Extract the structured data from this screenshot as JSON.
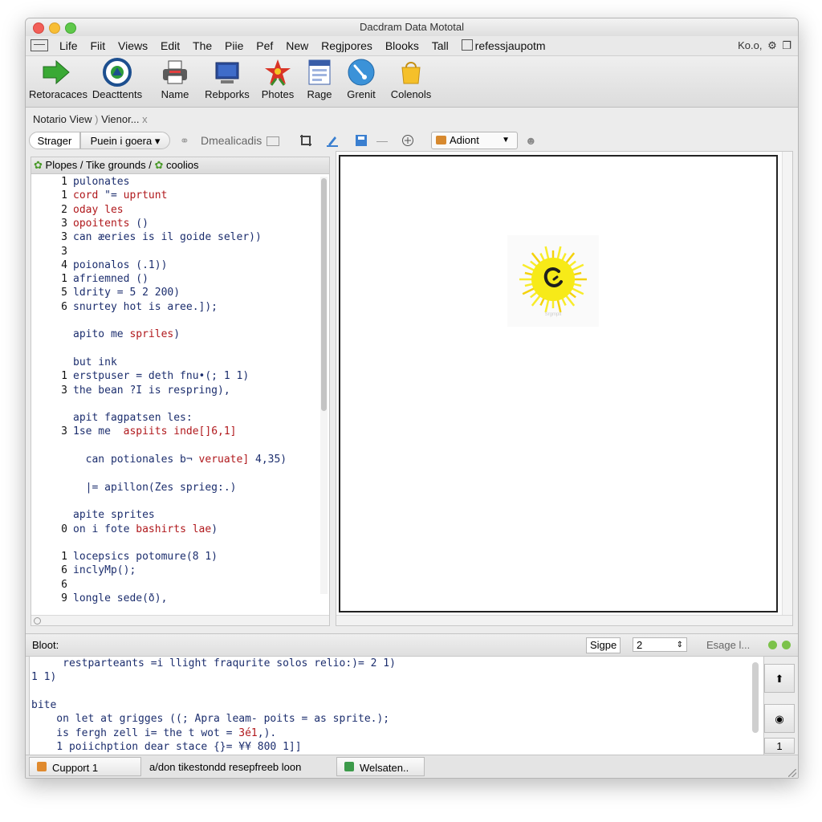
{
  "window": {
    "title": "Dacdram Data Mototal"
  },
  "menubar": {
    "items": [
      "Life",
      "Fiit",
      "Views",
      "Edit",
      "The",
      "Piie",
      "Pef",
      "New",
      "Regjpores",
      "Blooks",
      "Tall"
    ],
    "checkbox_label": "refessjaupotm",
    "right_text": "Ko.o,"
  },
  "toolbar": {
    "buttons": [
      {
        "label": "Retoracaces",
        "icon": "green-arrow-icon"
      },
      {
        "label": "Deacttents",
        "icon": "circle-target-icon"
      },
      {
        "label": "Name",
        "icon": "printer-icon"
      },
      {
        "label": "Rebporks",
        "icon": "monitor-icon"
      },
      {
        "label": "Photes",
        "icon": "flower-icon"
      },
      {
        "label": "Rage",
        "icon": "calendar-icon"
      },
      {
        "label": "Grenit",
        "icon": "globe-icon"
      },
      {
        "label": "Colenols",
        "icon": "bag-icon"
      }
    ]
  },
  "breadcrumb": {
    "item1": "Notario View",
    "sep": ")",
    "item2": "Vienor...",
    "close": "x"
  },
  "subtoolbar": {
    "tab1": "Strager",
    "tab2": "Puein i goera",
    "caret": "▾",
    "text": "Dmealicadis",
    "dropdown_value": "Adiont"
  },
  "left_pane": {
    "header_a": "Plopes",
    "header_sep": "/",
    "header_b": "Tike grounds",
    "header_c": "coolios",
    "lines": [
      {
        "n": "1",
        "t": [
          {
            "s": "pulonates",
            "c": "kw"
          }
        ]
      },
      {
        "n": "1",
        "t": [
          {
            "s": "cord ",
            "c": "rd"
          },
          {
            "s": "\"= ",
            "c": "kw"
          },
          {
            "s": "uprtunt",
            "c": "rd"
          }
        ]
      },
      {
        "n": "2",
        "t": [
          {
            "s": "oday les",
            "c": "rd"
          }
        ]
      },
      {
        "n": "3",
        "t": [
          {
            "s": "opoitents",
            "c": "rd"
          },
          {
            "s": " ()",
            "c": "kw"
          }
        ]
      },
      {
        "n": "3",
        "t": [
          {
            "s": "can æeries is il goide seler))",
            "c": "kw"
          }
        ]
      },
      {
        "n": "3",
        "t": []
      },
      {
        "n": "4",
        "t": [
          {
            "s": "poionalos (.1))",
            "c": "kw"
          }
        ]
      },
      {
        "n": "1",
        "t": [
          {
            "s": "afriemned ()",
            "c": "kw"
          }
        ]
      },
      {
        "n": "5",
        "t": [
          {
            "s": "ldrity = 5 2 200)",
            "c": "kw"
          }
        ]
      },
      {
        "n": "6",
        "t": [
          {
            "s": "snurtey hot is aree.]);",
            "c": "kw"
          }
        ]
      },
      {
        "n": "",
        "t": []
      },
      {
        "n": "",
        "t": [
          {
            "s": "apito me ",
            "c": "kw"
          },
          {
            "s": "spriles",
            "c": "rd"
          },
          {
            "s": ")",
            "c": "kw"
          }
        ]
      },
      {
        "n": "",
        "t": []
      },
      {
        "n": "",
        "t": [
          {
            "s": "but ink",
            "c": "kw"
          }
        ]
      },
      {
        "n": "1",
        "t": [
          {
            "s": "erstpuser = deth fnu•(; 1 1)",
            "c": "kw"
          }
        ]
      },
      {
        "n": "3",
        "t": [
          {
            "s": "the bean ?I is respring),",
            "c": "kw"
          }
        ]
      },
      {
        "n": "",
        "t": []
      },
      {
        "n": "",
        "t": [
          {
            "s": "apit fagpatsen les:",
            "c": "kw"
          }
        ]
      },
      {
        "n": "3",
        "t": [
          {
            "s": "1se me  ",
            "c": "kw"
          },
          {
            "s": "aspiits inde[]6,1]",
            "c": "rd"
          }
        ]
      },
      {
        "n": "",
        "t": []
      },
      {
        "n": "",
        "t": [
          {
            "s": "  can potionales b¬ ",
            "c": "kw"
          },
          {
            "s": "veruate]",
            "c": "rd"
          },
          {
            "s": " 4,35)",
            "c": "kw"
          }
        ]
      },
      {
        "n": "",
        "t": []
      },
      {
        "n": "",
        "t": [
          {
            "s": "  |= apillon(Zes sprieg:.)",
            "c": "kw"
          }
        ]
      },
      {
        "n": "",
        "t": []
      },
      {
        "n": "",
        "t": [
          {
            "s": "apite sprites",
            "c": "kw"
          }
        ]
      },
      {
        "n": "0",
        "t": [
          {
            "s": "on i fote ",
            "c": "kw"
          },
          {
            "s": "bashirts lae",
            "c": "rd"
          },
          {
            "s": ")",
            "c": "kw"
          }
        ]
      },
      {
        "n": "",
        "t": []
      },
      {
        "n": "1",
        "t": [
          {
            "s": "locepsics potomure(8 1)",
            "c": "kw"
          }
        ]
      },
      {
        "n": "6",
        "t": [
          {
            "s": "inclyMp();",
            "c": "kw"
          }
        ]
      },
      {
        "n": "6",
        "t": []
      },
      {
        "n": "9",
        "t": [
          {
            "s": "longle sede(ð),",
            "c": "kw"
          }
        ]
      }
    ]
  },
  "bottom_bar": {
    "label": "Bloot:",
    "btn": "Sigpe",
    "value": "2",
    "status": "Esage l..."
  },
  "console": {
    "lines": [
      {
        "n": "",
        "t": [
          {
            "s": "     restparteants =i llight fraqurite solos relio:)= 2 1)",
            "c": "kw"
          }
        ]
      },
      {
        "n": "",
        "t": [
          {
            "s": "1 1)",
            "c": "kw"
          }
        ]
      },
      {
        "n": "",
        "t": []
      },
      {
        "n": "",
        "t": [
          {
            "s": "bite",
            "c": "kw"
          }
        ]
      },
      {
        "n": "",
        "t": [
          {
            "s": "    on let at grigges ((; Apra leam- poits = as sprite.);",
            "c": "kw"
          }
        ]
      },
      {
        "n": "",
        "t": [
          {
            "s": "    is fergh zell i= the t wot = ",
            "c": "kw"
          },
          {
            "s": "3é1",
            "c": "rd"
          },
          {
            "s": ",).",
            "c": "kw"
          }
        ]
      },
      {
        "n": "",
        "t": [
          {
            "s": "    1 poiichption dear stace {}= ",
            "c": "kw"
          },
          {
            "s": "¥¥ 800 1]]",
            "c": "kw"
          }
        ]
      }
    ],
    "side_btn3": "1"
  },
  "statusbar": {
    "item1": "Cupport 1",
    "item2": "a/don tikestondd  resepfreeb loon",
    "item3": "Welsaten.."
  },
  "canvas": {
    "sprite_caption": "Srgmplt"
  },
  "colors": {
    "keyword": "#1c2e6e",
    "string": "#b0181c",
    "window_bg": "#ececec"
  }
}
